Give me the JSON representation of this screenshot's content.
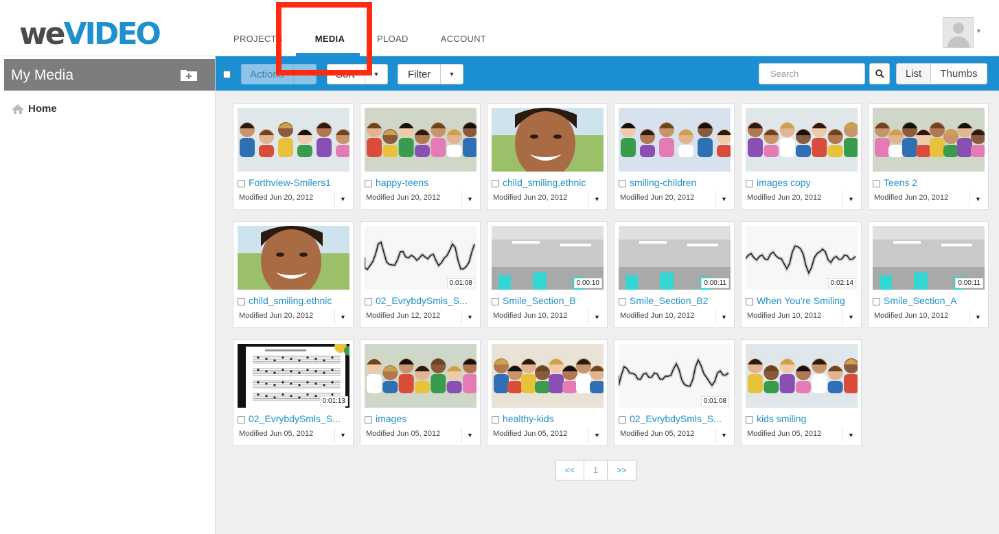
{
  "logo": {
    "we": "we",
    "video": "VIDEO"
  },
  "nav": [
    {
      "label": "PROJECTS"
    },
    {
      "label": "MEDIA"
    },
    {
      "label": "PLOAD"
    },
    {
      "label": "ACCOUNT"
    }
  ],
  "sidebar": {
    "title": "My Media",
    "home": "Home"
  },
  "toolbar": {
    "actions": "Actions",
    "sort": "Sort",
    "filter": "Filter",
    "search_placeholder": "Search",
    "list": "List",
    "thumbs": "Thumbs"
  },
  "colors": {
    "brand_blue": "#1b8fd2",
    "highlight": "#ff2a10"
  },
  "media": [
    {
      "title": "Forthview-Smilers1",
      "modified": "Modified Jun 20, 2012",
      "duration": "",
      "thumb": "group-photo"
    },
    {
      "title": "happy-teens",
      "modified": "Modified Jun 20, 2012",
      "duration": "",
      "thumb": "group-photo"
    },
    {
      "title": "child_smiling.ethnic",
      "modified": "Modified Jun 20, 2012",
      "duration": "",
      "thumb": "portrait"
    },
    {
      "title": "smiling-children",
      "modified": "Modified Jun 20, 2012",
      "duration": "",
      "thumb": "group-photo"
    },
    {
      "title": "images copy",
      "modified": "Modified Jun 20, 2012",
      "duration": "",
      "thumb": "group-photo"
    },
    {
      "title": "Teens 2",
      "modified": "Modified Jun 20, 2012",
      "duration": "",
      "thumb": "group-photo"
    },
    {
      "title": "child_smiling.ethnic",
      "modified": "Modified Jun 20, 2012",
      "duration": "",
      "thumb": "portrait"
    },
    {
      "title": "02_EvrybdySmls_S...",
      "modified": "Modified Jun 12, 2012",
      "duration": "0:01:08",
      "thumb": "waveform"
    },
    {
      "title": "Smile_Section_B",
      "modified": "Modified Jun 10, 2012",
      "duration": "0:00:10",
      "thumb": "room"
    },
    {
      "title": "Smile_Section_B2",
      "modified": "Modified Jun 10, 2012",
      "duration": "0:00:11",
      "thumb": "room"
    },
    {
      "title": "When You're Smiling",
      "modified": "Modified Jun 10, 2012",
      "duration": "0:02:14",
      "thumb": "waveform"
    },
    {
      "title": "Smile_Section_A",
      "modified": "Modified Jun 10, 2012",
      "duration": "0:00:11",
      "thumb": "room"
    },
    {
      "title": "02_EvrybdySmls_S...",
      "modified": "Modified Jun 05, 2012",
      "duration": "0:01:13",
      "thumb": "sheet-music"
    },
    {
      "title": "images",
      "modified": "Modified Jun 05, 2012",
      "duration": "",
      "thumb": "group-photo"
    },
    {
      "title": "healthy-kids",
      "modified": "Modified Jun 05, 2012",
      "duration": "",
      "thumb": "group-photo"
    },
    {
      "title": "02_EvrybdySmls_S...",
      "modified": "Modified Jun 05, 2012",
      "duration": "0:01:08",
      "thumb": "waveform"
    },
    {
      "title": "kids smiling",
      "modified": "Modified Jun 05, 2012",
      "duration": "",
      "thumb": "group-photo"
    }
  ],
  "pager": {
    "prev": "<<",
    "page": "1",
    "next": ">>"
  }
}
